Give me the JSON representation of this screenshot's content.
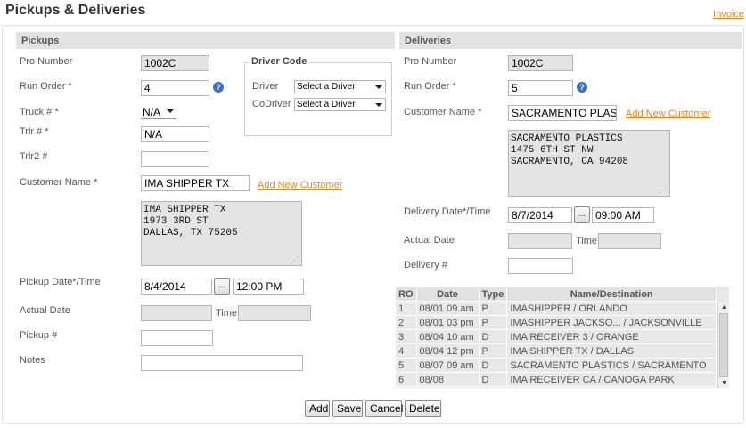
{
  "page": {
    "title": "Pickups & Deliveries",
    "invoice_link": "Invoice"
  },
  "pickups": {
    "header": "Pickups",
    "pro_number_label": "Pro Number",
    "pro_number": "1002C",
    "run_order_label": "Run Order *",
    "run_order": "4",
    "truck_label": "Truck # *",
    "truck": "N/A",
    "trlr_label": "Trlr # *",
    "trlr": "N/A",
    "trlr2_label": "Trlr2 #",
    "trlr2": "",
    "customer_name_label": "Customer Name *",
    "customer_name": "IMA SHIPPER TX",
    "add_customer": "Add New Customer",
    "address": "IMA SHIPPER TX\n1973 3RD ST\nDALLAS, TX 75205",
    "pickup_datetime_label": "Pickup Date*/Time",
    "pickup_date": "8/4/2014",
    "pickup_time": "12:00 PM",
    "actual_date_label": "Actual Date",
    "time_label": "Time",
    "pickup_num_label": "Pickup #",
    "notes_label": "Notes"
  },
  "driver_code": {
    "legend": "Driver Code",
    "driver_label": "Driver",
    "driver_value": "Select a Driver",
    "codriver_label": "CoDriver",
    "codriver_value": "Select a Driver"
  },
  "deliveries": {
    "header": "Deliveries",
    "pro_number_label": "Pro Number",
    "pro_number": "1002C",
    "run_order_label": "Run Order *",
    "run_order": "5",
    "customer_name_label": "Customer Name *",
    "customer_name": "SACRAMENTO PLASTI",
    "add_customer": "Add New Customer",
    "address": "SACRAMENTO PLASTICS\n1475 6TH ST NW\nSACRAMENTO, CA 94208",
    "delivery_datetime_label": "Delivery Date*/Time",
    "delivery_date": "8/7/2014",
    "delivery_time": "09:00 AM",
    "actual_date_label": "Actual Date",
    "time_label": "Time",
    "delivery_num_label": "Delivery #"
  },
  "stops_table": {
    "headers": [
      "RO",
      "Date",
      "Type",
      "Name/Destination"
    ],
    "rows": [
      [
        "1",
        "08/01 09 am",
        "P",
        "IMASHIPPER / ORLANDO"
      ],
      [
        "2",
        "08/01 03 pm",
        "P",
        "IMASHIPPER JACKSO... / JACKSONVILLE"
      ],
      [
        "3",
        "08/04 10 am",
        "D",
        "IMA RECEIVER 3 / ORANGE"
      ],
      [
        "4",
        "08/04 12 pm",
        "P",
        "IMA SHIPPER TX / DALLAS"
      ],
      [
        "5",
        "08/07 09 am",
        "D",
        "SACRAMENTO PLASTICS / SACRAMENTO"
      ],
      [
        "6",
        "08/08",
        "D",
        "IMA RECEIVER CA / CANOGA PARK"
      ]
    ]
  },
  "buttons": {
    "add": "Add",
    "save": "Save",
    "cancel": "Cancel",
    "delete": "Delete",
    "dots": "..."
  },
  "icons": {
    "help": "help-icon",
    "dropdown": "chevron-down-icon",
    "resize": "resize-grip-icon"
  }
}
